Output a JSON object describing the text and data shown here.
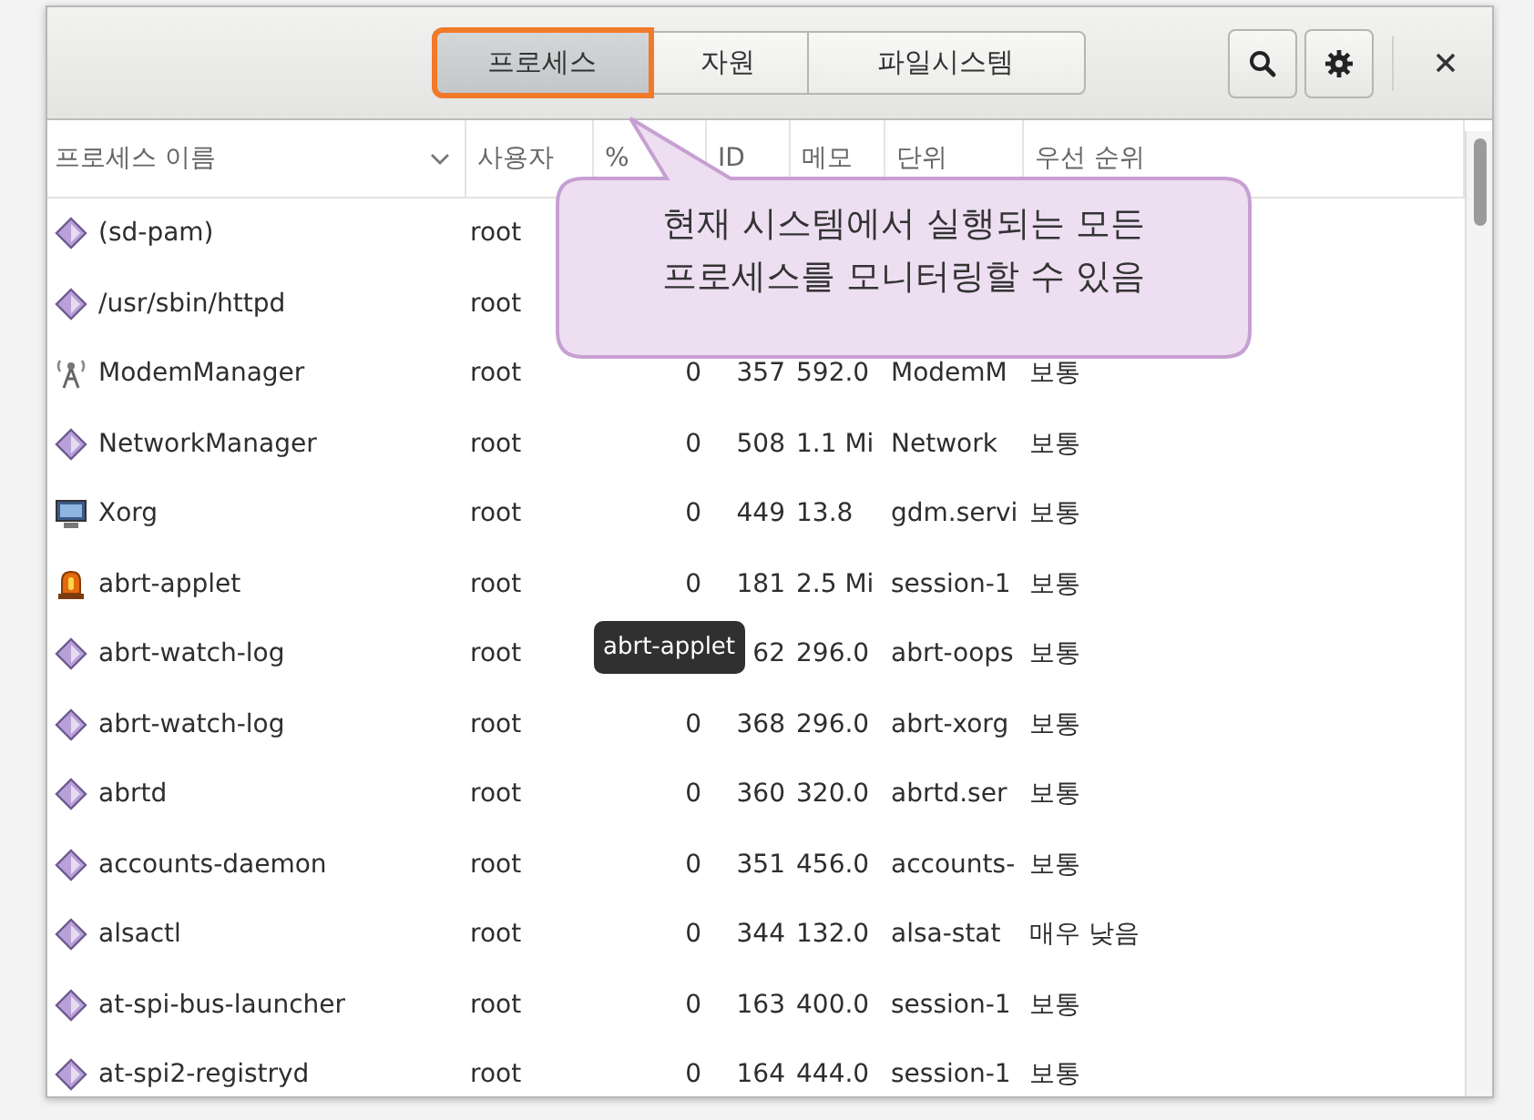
{
  "tabs": [
    {
      "label": "프로세스",
      "selected": true
    },
    {
      "label": "자원",
      "selected": false
    },
    {
      "label": "파일시스템",
      "selected": false
    }
  ],
  "table": {
    "columns": [
      {
        "label": "프로세스 이름",
        "sorted": true
      },
      {
        "label": "사용자",
        "sorted": false
      },
      {
        "label": "%",
        "sorted": false
      },
      {
        "label": "ID",
        "sorted": false
      },
      {
        "label": "메모",
        "sorted": false
      },
      {
        "label": "단위",
        "sorted": false
      },
      {
        "label": "우선 순위",
        "sorted": false
      }
    ],
    "rows": [
      {
        "kind": "generic",
        "cells": [
          "(sd-pam)",
          "root"
        ]
      },
      {
        "kind": "generic",
        "cells": [
          "/usr/sbin/httpd",
          "root"
        ]
      },
      {
        "kind": "antenna",
        "cells": [
          "ModemManager",
          "root",
          "0",
          "357",
          "592.0",
          "ModemM",
          "보통"
        ]
      },
      {
        "kind": "generic",
        "cells": [
          "NetworkManager",
          "root",
          "0",
          "508",
          "1.1 Mi",
          "Network",
          "보통"
        ]
      },
      {
        "kind": "monitor",
        "cells": [
          "Xorg",
          "root",
          "0",
          "449",
          "13.8",
          "gdm.servi",
          "보통"
        ]
      },
      {
        "kind": "alarm",
        "cells": [
          "abrt-applet",
          "root",
          "0",
          "181",
          "2.5 Mi",
          "session-1",
          "보통"
        ]
      },
      {
        "kind": "generic",
        "cells": [
          "abrt-watch-log",
          "root",
          "",
          "62",
          "296.0",
          "abrt-oops",
          "보통"
        ]
      },
      {
        "kind": "generic",
        "cells": [
          "abrt-watch-log",
          "root",
          "0",
          "368",
          "296.0",
          "abrt-xorg",
          "보통"
        ]
      },
      {
        "kind": "generic",
        "cells": [
          "abrtd",
          "root",
          "0",
          "360",
          "320.0",
          "abrtd.ser",
          "보통"
        ]
      },
      {
        "kind": "generic",
        "cells": [
          "accounts-daemon",
          "root",
          "0",
          "351",
          "456.0",
          "accounts-",
          "보통"
        ]
      },
      {
        "kind": "generic",
        "cells": [
          "alsactl",
          "root",
          "0",
          "344",
          "132.0",
          "alsa-stat",
          "매우 낮음"
        ]
      },
      {
        "kind": "generic",
        "cells": [
          "at-spi-bus-launcher",
          "root",
          "0",
          "163",
          "400.0",
          "session-1",
          "보통"
        ]
      },
      {
        "kind": "generic",
        "cells": [
          "at-spi2-registryd",
          "root",
          "0",
          "164",
          "444.0",
          "session-1",
          "보통"
        ]
      }
    ]
  },
  "tooltip": {
    "text": "abrt-applet"
  },
  "callout": {
    "text": "현재 시스템에서 실행되는 모든\n프로세스를 모니터링할 수 있음"
  }
}
